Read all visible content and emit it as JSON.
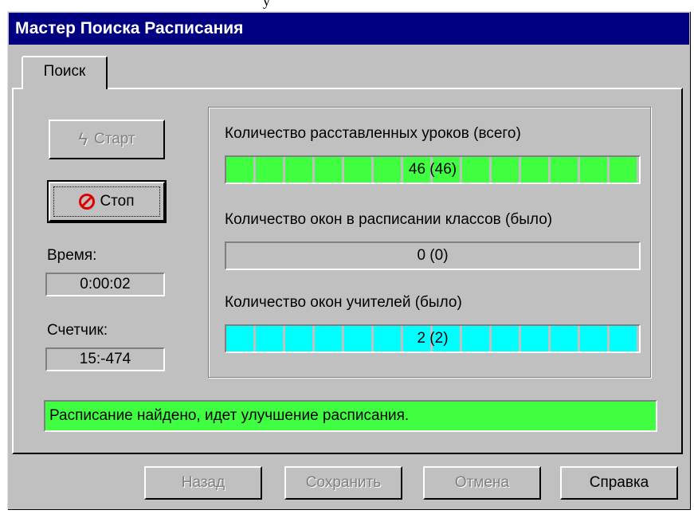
{
  "window": {
    "title": "Мастер Поиска Расписания"
  },
  "tabs": [
    {
      "label": "Поиск",
      "selected": true
    }
  ],
  "left": {
    "start_button": {
      "label": "Старт",
      "icon": "lightning-icon",
      "enabled": false
    },
    "stop_button": {
      "label": "Стоп",
      "icon": "stop-icon",
      "enabled": true
    },
    "time_label": "Время:",
    "time_value": "0:00:02",
    "counter_label": "Счетчик:",
    "counter_value": "15:-474"
  },
  "stats": [
    {
      "label": "Количество расставленных уроков (всего)",
      "value": "46 (46)",
      "progress": 1.0,
      "color": "#40ff40"
    },
    {
      "label": "Количество окон в расписании классов (было)",
      "value": "0 (0)",
      "progress": 0.0,
      "color": "#40ff40"
    },
    {
      "label": "Количество окон учителей (было)",
      "value": "2 (2)",
      "progress": 1.0,
      "color": "#00ffff"
    }
  ],
  "status": {
    "text": "Расписание найдено, идет улучшение расписания.",
    "color": "#40ff40"
  },
  "buttons": {
    "back": "Назад",
    "save": "Сохранить",
    "cancel": "Отмена",
    "help": "Справка"
  }
}
